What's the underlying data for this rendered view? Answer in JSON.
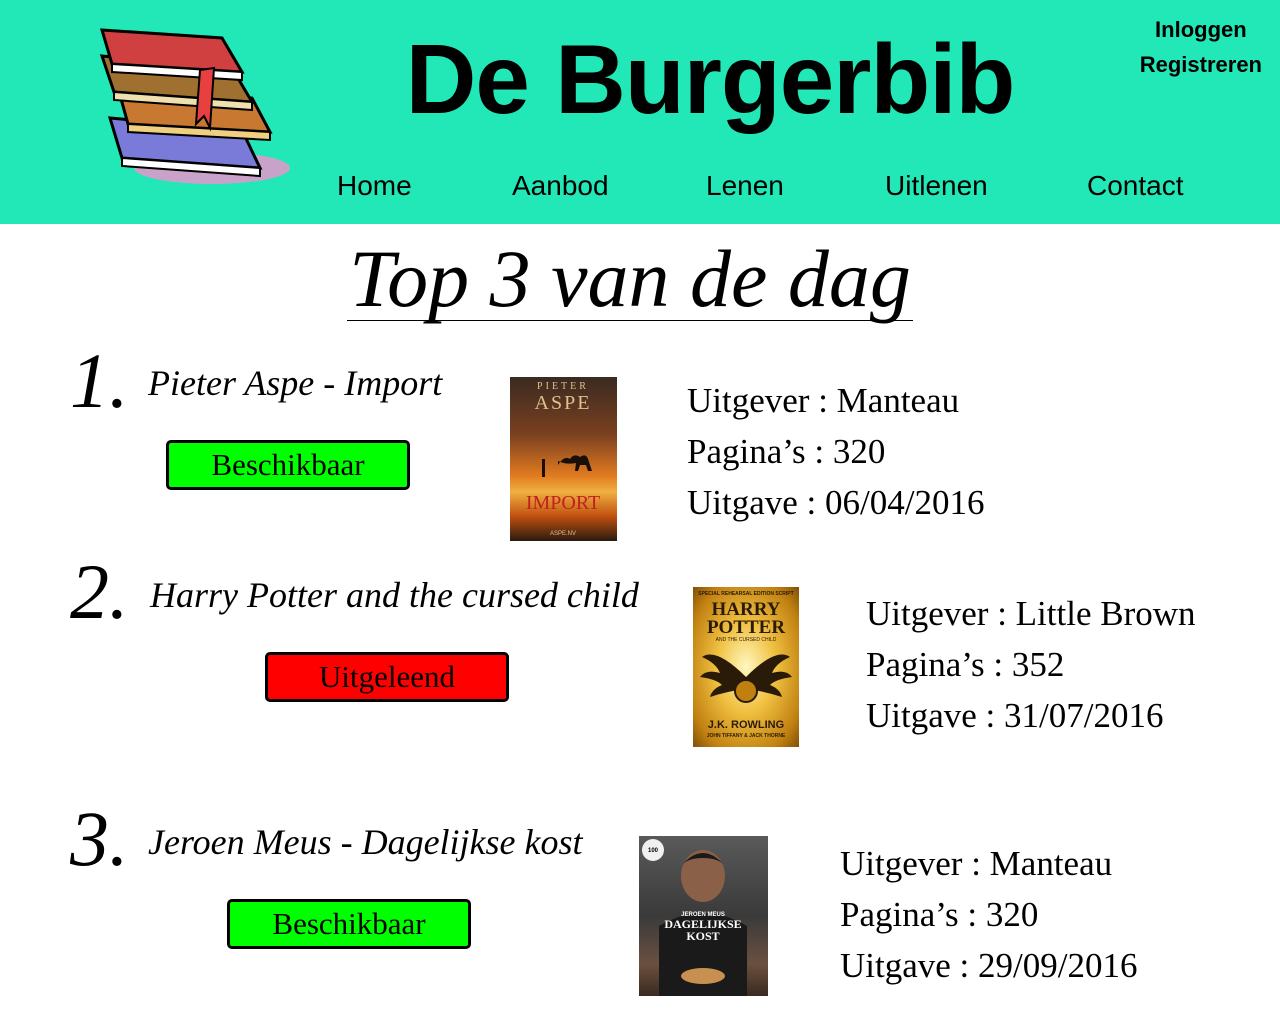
{
  "site": {
    "title": "De Burgerbib"
  },
  "auth": {
    "login": "Inloggen",
    "register": "Registreren"
  },
  "nav": {
    "items": [
      "Home",
      "Aanbod",
      "Lenen",
      "Uitlenen",
      "Contact"
    ]
  },
  "main": {
    "heading": "Top 3 van de dag",
    "books": [
      {
        "rank": "1.",
        "title": "Pieter Aspe - Import",
        "status": "Beschikbaar",
        "status_color": "#00ff00",
        "cover": {
          "author": "PIETER ASPE",
          "title": "IMPORT",
          "footer": "ASPE.NV"
        },
        "publisher": "Uitgever : Manteau",
        "pages": "Pagina’s : 320",
        "release": "Uitgave : 06/04/2016"
      },
      {
        "rank": "2.",
        "title": "Harry Potter and the cursed child",
        "status": "Uitgeleend",
        "status_color": "#ff0000",
        "cover": {
          "top": "SPECIAL REHEARSAL EDITION SCRIPT",
          "title1": "HARRY",
          "title2": "POTTER",
          "sub": "AND THE CURSED CHILD",
          "author": "J.K. ROWLING",
          "footer": "JOHN TIFFANY & JACK THORNE"
        },
        "publisher": "Uitgever : Little Brown",
        "pages": "Pagina’s : 352",
        "release": "Uitgave : 31/07/2016"
      },
      {
        "rank": "3.",
        "title": "Jeroen Meus - Dagelijkse kost",
        "status": "Beschikbaar",
        "status_color": "#00ff00",
        "cover": {
          "author": "JEROEN MEUS",
          "title1": "DAGELIJKSE",
          "title2": "KOST",
          "badge": "100"
        },
        "publisher": "Uitgever : Manteau",
        "pages": "Pagina’s : 320",
        "release": "Uitgave : 29/09/2016"
      }
    ]
  },
  "colors": {
    "header_bg": "#21e8b6",
    "available": "#00ff00",
    "lent": "#ff0000"
  },
  "icons": {
    "logo": "book-stack-icon"
  }
}
